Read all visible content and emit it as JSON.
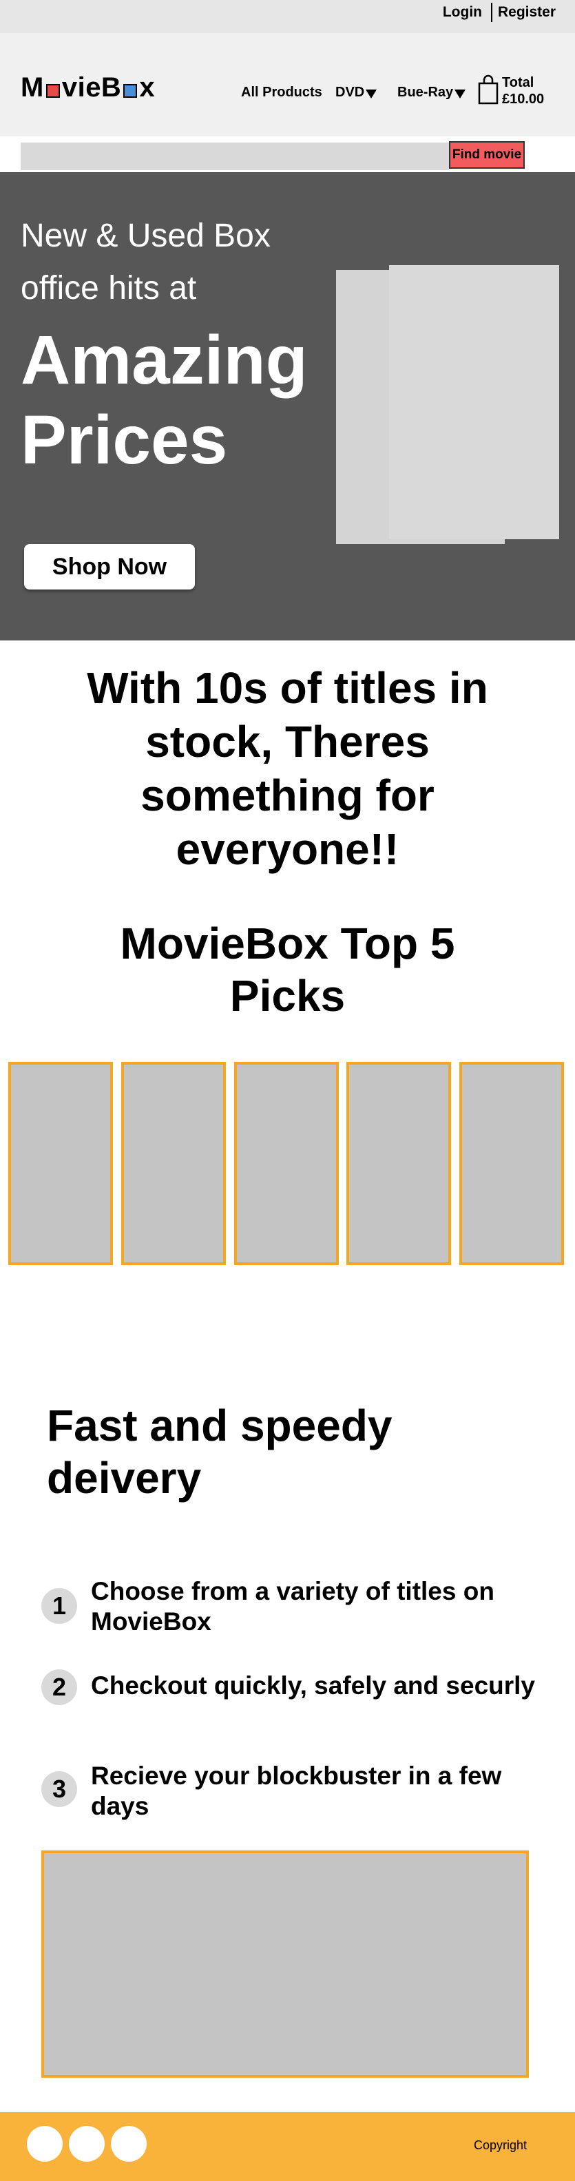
{
  "topbar": {
    "login": "Login",
    "register": "Register"
  },
  "header": {
    "logo": {
      "part1": "M",
      "part2": "vieB",
      "part3": "x"
    },
    "nav": {
      "all_products": "All Products",
      "dvd": "DVD",
      "bluray": "Bue-Ray"
    },
    "cart": {
      "label": "Total",
      "amount": "£10.00"
    }
  },
  "search": {
    "placeholder": "",
    "button": "Find movie"
  },
  "hero": {
    "subtitle": "New & Used Box office hits at",
    "title": "Amazing Prices",
    "cta": "Shop Now"
  },
  "tagline": "With 10s of titles in stock, Theres something for everyone!!",
  "picks": {
    "title": "MovieBox Top 5 Picks",
    "count": 5
  },
  "delivery": {
    "title": "Fast and speedy deivery",
    "steps": [
      {
        "num": "1",
        "text": "Choose from a variety of titles on MovieBox"
      },
      {
        "num": "2",
        "text": "Checkout quickly, safely and securly"
      },
      {
        "num": "3",
        "text": "Recieve your blockbuster in a few days"
      }
    ]
  },
  "footer": {
    "copyright": "Copyright"
  },
  "colors": {
    "accent": "#f5a623",
    "footer": "#f9b23a",
    "hero_bg": "#575757",
    "find_button": "#f25c5c"
  }
}
